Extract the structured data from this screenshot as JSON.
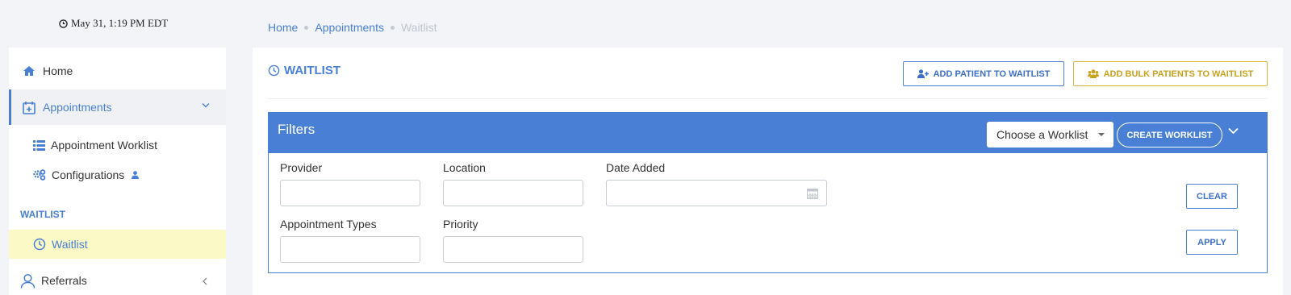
{
  "header": {
    "datetime": "May 31, 1:19 PM EDT"
  },
  "breadcrumb": {
    "items": [
      "Home",
      "Appointments"
    ],
    "current": "Waitlist"
  },
  "sidebar": {
    "home": "Home",
    "appointments": "Appointments",
    "appointment_worklist": "Appointment Worklist",
    "configurations": "Configurations",
    "section_waitlist": "WAITLIST",
    "waitlist": "Waitlist",
    "referrals": "Referrals"
  },
  "page": {
    "title": "WAITLIST",
    "add_patient_label": "ADD PATIENT TO WAITLIST",
    "add_bulk_label": "ADD BULK PATIENTS TO WAITLIST"
  },
  "filters": {
    "title": "Filters",
    "worklist_select": "Choose a Worklist",
    "create_worklist_label": "CREATE WORKLIST",
    "fields": {
      "provider": {
        "label": "Provider",
        "value": ""
      },
      "location": {
        "label": "Location",
        "value": ""
      },
      "date_added": {
        "label": "Date Added",
        "value": ""
      },
      "appointment_types": {
        "label": "Appointment Types",
        "value": ""
      },
      "priority": {
        "label": "Priority",
        "value": ""
      }
    },
    "clear_label": "CLEAR",
    "apply_label": "APPLY"
  },
  "colors": {
    "accent": "#4a7fd6",
    "bulk_accent": "#c9a21e",
    "active_highlight": "#fbfac7"
  },
  "icons": [
    "clock-icon",
    "home-icon",
    "calendar-plus-icon",
    "chevron-down-icon",
    "list-icon",
    "cogs-icon",
    "user-icon",
    "history-icon",
    "person-icon",
    "chevron-left-icon",
    "user-plus-icon",
    "users-icon",
    "calendar-icon"
  ]
}
